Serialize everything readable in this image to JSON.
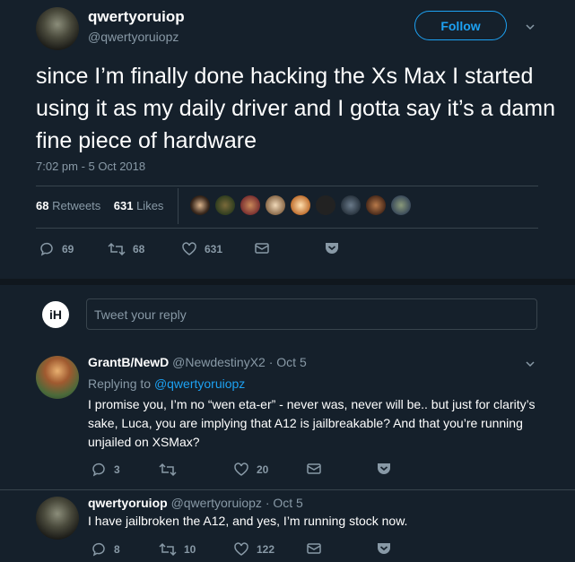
{
  "main_tweet": {
    "display_name": "qwertyoruiop",
    "handle": "@qwertyoruiopz",
    "follow_label": "Follow",
    "text": "since I’m finally done hacking the Xs Max I started using it as my daily driver and I gotta say it’s a damn fine piece of hardware",
    "timestamp": "7:02 pm - 5 Oct 2018",
    "retweets_count": "68",
    "retweets_label": "Retweets",
    "likes_count": "631",
    "likes_label": "Likes",
    "actions": {
      "replies": "69",
      "retweets": "68",
      "likes": "631"
    }
  },
  "reply_box": {
    "logo_text": "iH",
    "placeholder": "Tweet your reply"
  },
  "replies": [
    {
      "display_name": "GrantB/NewD",
      "handle": "@NewdestinyX2",
      "date": "· Oct 5",
      "replying_prefix": "Replying to",
      "replying_to": "@qwertyoruiopz",
      "text": "I promise you, I’m no “wen eta-er” - never was, never will be.. but just for clarity’s sake, Luca, you are implying that A12 is jailbreakable? And that you’re running unjailed on XSMax?",
      "actions": {
        "replies": "3",
        "retweets": "",
        "likes": "20"
      }
    },
    {
      "display_name": "qwertyoruiop",
      "handle": "@qwertyoruiopz",
      "date": "· Oct 5",
      "text": "I have jailbroken the A12, and yes, I’m running stock now.",
      "actions": {
        "replies": "8",
        "retweets": "10",
        "likes": "122"
      }
    }
  ],
  "colors": {
    "accent": "#1da1f2",
    "background": "#15202b",
    "secondary_text": "#8899a6",
    "divider": "#38444d"
  }
}
